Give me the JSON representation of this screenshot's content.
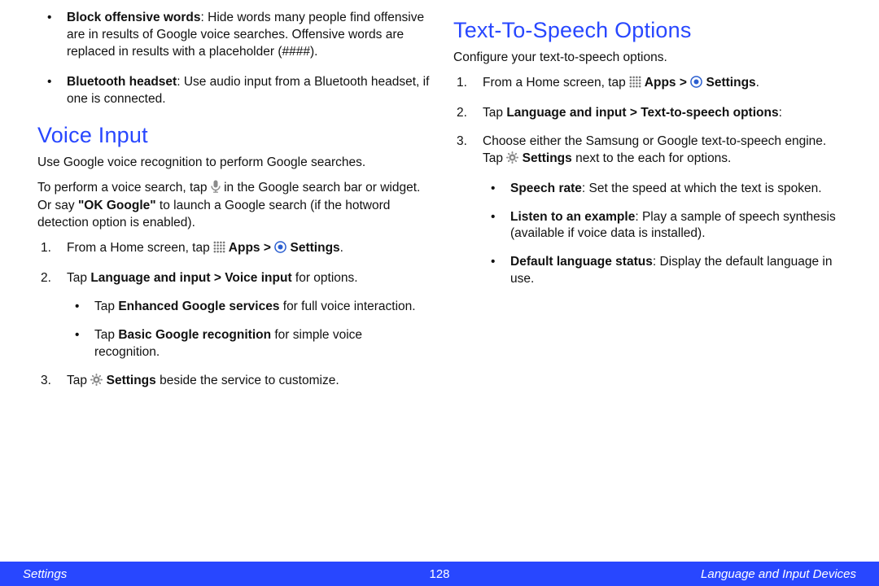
{
  "left": {
    "bullet1_bold": "Block offensive words",
    "bullet1_rest": ": Hide words many people find offensive are in results of Google voice searches. Offensive words are replaced in results with a placeholder (####).",
    "bullet2_bold": "Bluetooth headset",
    "bullet2_rest": ": Use audio input from a Bluetooth headset, if one is connected.",
    "heading": "Voice Input",
    "intro1": "Use Google voice recognition to perform Google searches.",
    "intro2a": "To perform a voice search, tap ",
    "intro2b": " in the Google search bar or widget. Or say ",
    "intro2_quote": "\"OK Google\"",
    "intro2c": " to launch a Google search (if the hotword detection option is enabled).",
    "step1a": "From a Home screen, tap ",
    "step1_apps": " Apps > ",
    "step1_settings": " Settings",
    "step1b": ".",
    "step2a": "Tap ",
    "step2_bold": "Language and input > Voice input",
    "step2b": " for options.",
    "sub1a": "Tap ",
    "sub1_bold": "Enhanced Google services",
    "sub1b": " for full voice interaction.",
    "sub2a": "Tap ",
    "sub2_bold": "Basic Google recognition",
    "sub2b": " for simple voice recognition.",
    "step3a": "Tap ",
    "step3_bold": " Settings",
    "step3b": " beside the service to customize."
  },
  "right": {
    "heading": "Text-To-Speech Options",
    "intro": "Configure your text-to-speech options.",
    "step1a": "From a Home screen, tap ",
    "step1_apps": " Apps > ",
    "step1_settings": " Settings",
    "step1b": ".",
    "step2a": "Tap ",
    "step2_bold": "Language and input > Text-to-speech options",
    "step2b": ":",
    "step3a": "Choose either the Samsung or Google text-to-speech engine. Tap ",
    "step3_bold": " Settings",
    "step3b": " next to the each for options.",
    "sub1_bold": "Speech rate",
    "sub1_rest": ": Set the speed at which the text is spoken.",
    "sub2_bold": "Listen to an example",
    "sub2_rest": ": Play a sample of speech synthesis (available if voice data is installed).",
    "sub3_bold": "Default language status",
    "sub3_rest": ": Display the default language in use."
  },
  "footer": {
    "left": "Settings",
    "page": "128",
    "right": "Language and Input Devices"
  }
}
